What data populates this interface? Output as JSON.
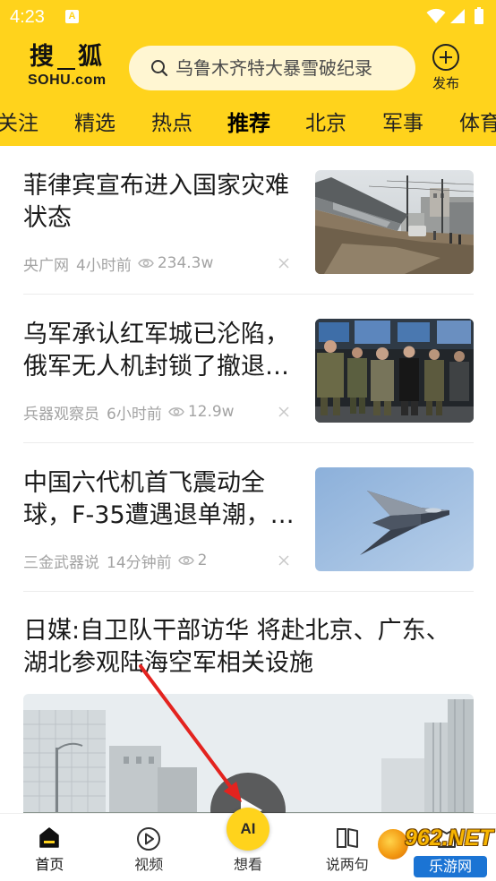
{
  "status_bar": {
    "time": "4:23",
    "notification_label": "A",
    "icons": [
      "wifi-icon",
      "cell-signal-icon",
      "battery-icon"
    ]
  },
  "header": {
    "logo": {
      "text": "搜狐",
      "sub": "SOHU.com"
    },
    "search": {
      "placeholder": "乌鲁木齐特大暴雪破纪录",
      "icon": "search-icon"
    },
    "publish": {
      "label": "发布",
      "icon": "plus-circle-icon"
    }
  },
  "tabs": [
    {
      "label": "关注",
      "active": false
    },
    {
      "label": "精选",
      "active": false
    },
    {
      "label": "热点",
      "active": false
    },
    {
      "label": "推荐",
      "active": true
    },
    {
      "label": "北京",
      "active": false
    },
    {
      "label": "军事",
      "active": false
    },
    {
      "label": "体育",
      "active": false
    }
  ],
  "feed": [
    {
      "title": "菲律宾宣布进入国家灾难状态",
      "source": "央广网",
      "time": "4小时前",
      "views": "234.3w"
    },
    {
      "title": "乌军承认红军城已沦陷，俄军无人机封锁了撤退…",
      "source": "兵器观察员",
      "time": "6小时前",
      "views": "12.9w"
    },
    {
      "title": "中国六代机首飞震动全球，F-35遭遇退单潮，…",
      "source": "三金武器说",
      "time": "14分钟前",
      "views": "2"
    },
    {
      "title": "日媒:自卫队干部访华 将赴北京、广东、湖北参观陆海空军相关设施"
    }
  ],
  "bottom_nav": [
    {
      "label": "首页",
      "icon": "home-icon",
      "active": true
    },
    {
      "label": "视频",
      "icon": "play-circle-icon",
      "active": false
    },
    {
      "label": "想看",
      "icon": "ai-icon",
      "badge": "AI",
      "active": false
    },
    {
      "label": "说两句",
      "icon": "book-icon",
      "active": false
    },
    {
      "icon": "flag-icon",
      "active": false
    }
  ],
  "watermark": {
    "brand": "962.NET",
    "name": "乐游网"
  },
  "colors": {
    "brand_yellow": "#FFD31C",
    "text": "#1a1a1a",
    "meta_gray": "#a3a3a3",
    "annotation_red": "#E3231F"
  }
}
